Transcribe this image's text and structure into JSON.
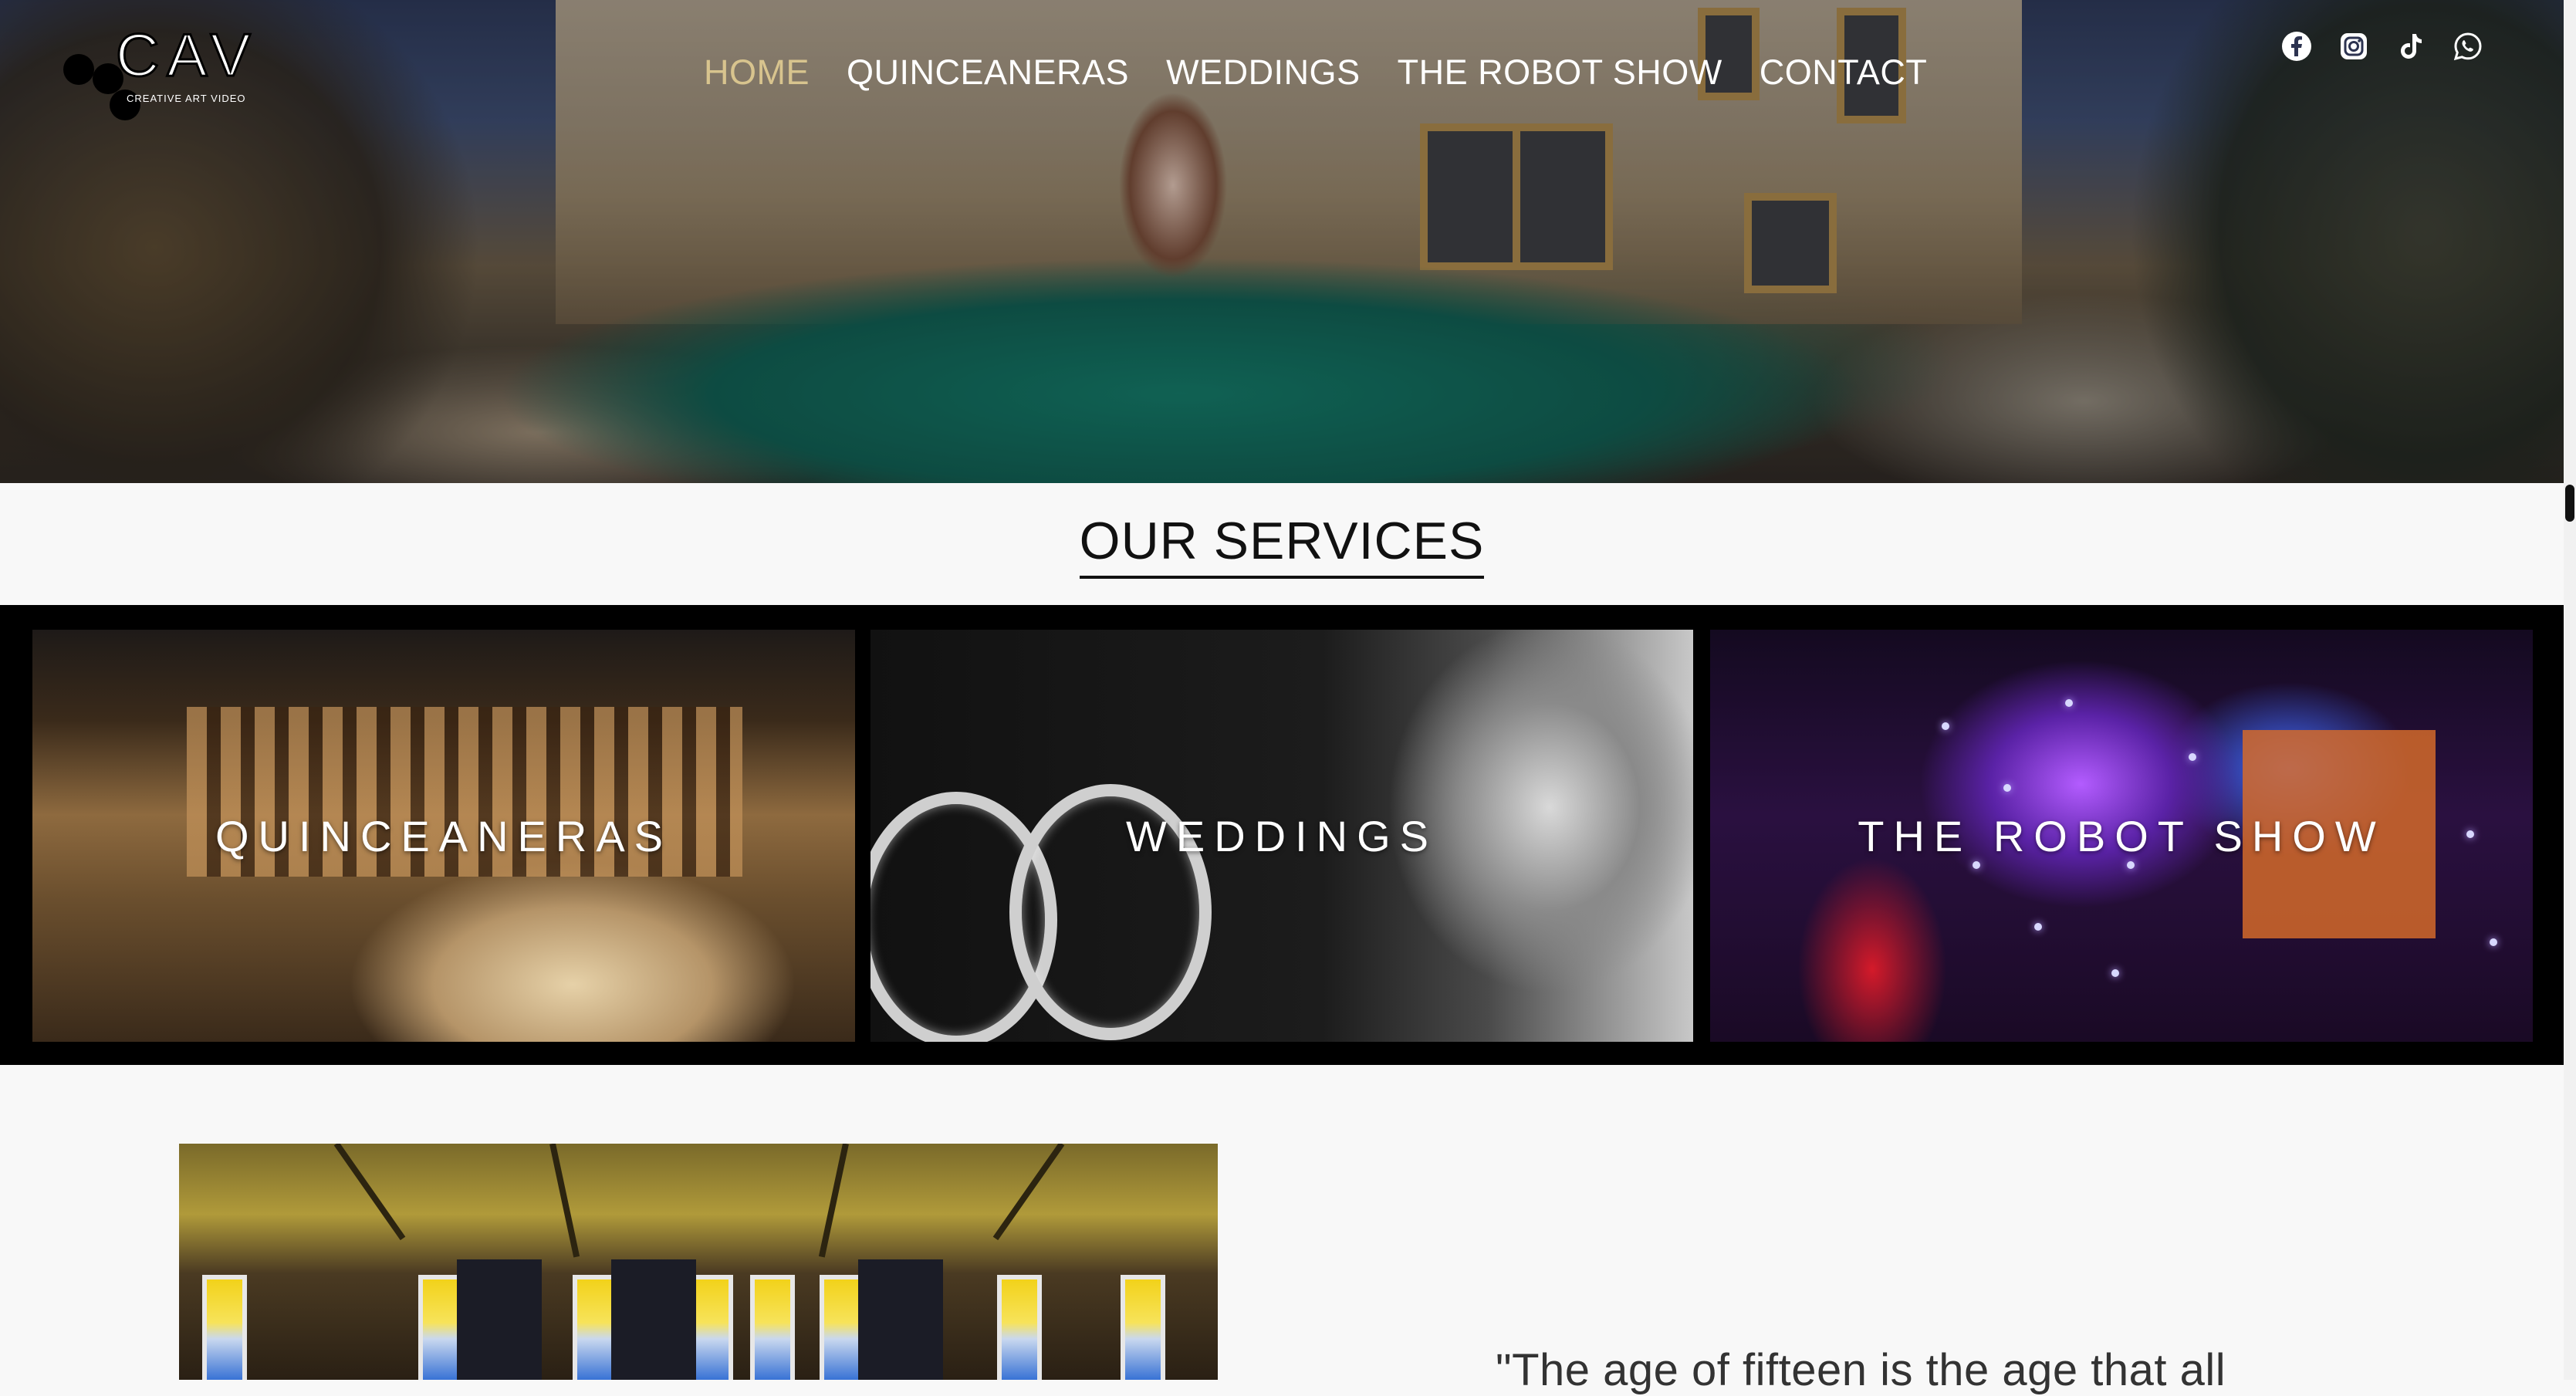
{
  "brand": {
    "logo_text": "CAV",
    "logo_tagline": "CREATIVE ART VIDEO"
  },
  "nav": {
    "items": [
      {
        "label": "HOME",
        "active": true
      },
      {
        "label": "QUINCEANERAS",
        "active": false
      },
      {
        "label": "WEDDINGS",
        "active": false
      },
      {
        "label": "THE ROBOT SHOW",
        "active": false
      },
      {
        "label": "CONTACT",
        "active": false
      }
    ],
    "active_color": "#d8c48e"
  },
  "social": [
    "facebook-icon",
    "instagram-icon",
    "tiktok-icon",
    "whatsapp-icon"
  ],
  "services": {
    "title": "OUR SERVICES",
    "cards": [
      {
        "label": "QUINCEANERAS"
      },
      {
        "label": "WEDDINGS"
      },
      {
        "label": "THE ROBOT SHOW"
      }
    ]
  },
  "intro": {
    "quote": "\"The age of fifteen is the age that all"
  }
}
